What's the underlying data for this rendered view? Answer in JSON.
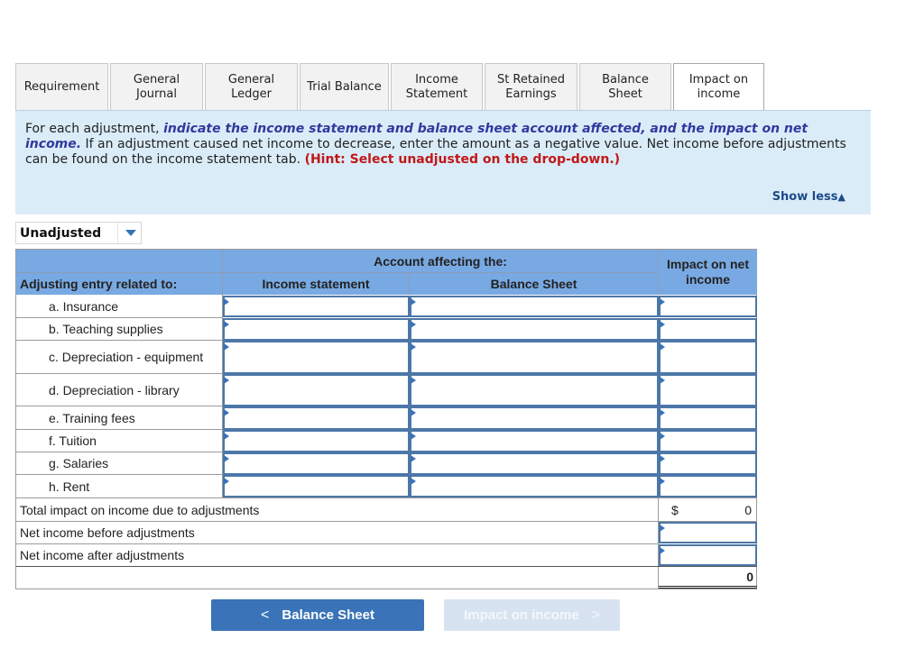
{
  "tabs": [
    {
      "label": "Requirement",
      "active": false
    },
    {
      "label": "General\nJournal",
      "active": false
    },
    {
      "label": "General\nLedger",
      "active": false
    },
    {
      "label": "Trial Balance",
      "active": false
    },
    {
      "label": "Income\nStatement",
      "active": false
    },
    {
      "label": "St Retained\nEarnings",
      "active": false
    },
    {
      "label": "Balance Sheet",
      "active": false
    },
    {
      "label": "Impact on\nincome",
      "active": true
    }
  ],
  "instructions": {
    "part1": "For each adjustment, ",
    "emphasis": "indicate the income statement and balance sheet account affected, and the impact on net income.",
    "part2": " If an adjustment caused net income to decrease, enter the amount as a negative value. Net income before adjustments can be found on the income statement tab. ",
    "hint": "(Hint: Select unadjusted on the drop-down.)",
    "show_less": "Show less",
    "show_less_icon": "triangle-up-icon"
  },
  "dropdown": {
    "selected": "Unadjusted",
    "icon": "chevron-down-icon"
  },
  "table": {
    "header_group": "Account affecting the:",
    "col_entry": "Adjusting entry related to:",
    "col_income_statement": "Income statement",
    "col_balance_sheet": "Balance Sheet",
    "col_impact": "Impact on net income",
    "rows": [
      {
        "label": "a.  Insurance",
        "income_statement": "",
        "balance_sheet": "",
        "impact": ""
      },
      {
        "label": "b.  Teaching supplies",
        "income_statement": "",
        "balance_sheet": "",
        "impact": ""
      },
      {
        "label": "c.  Depreciation - equipment",
        "income_statement": "",
        "balance_sheet": "",
        "impact": ""
      },
      {
        "label": "d.  Depreciation - library",
        "income_statement": "",
        "balance_sheet": "",
        "impact": ""
      },
      {
        "label": "e.  Training fees",
        "income_statement": "",
        "balance_sheet": "",
        "impact": ""
      },
      {
        "label": "f.  Tuition",
        "income_statement": "",
        "balance_sheet": "",
        "impact": ""
      },
      {
        "label": "g.  Salaries",
        "income_statement": "",
        "balance_sheet": "",
        "impact": ""
      },
      {
        "label": "h.  Rent",
        "income_statement": "",
        "balance_sheet": "",
        "impact": ""
      }
    ],
    "total_label": "Total impact on income due to adjustments",
    "total_currency": "$",
    "total_value": "0",
    "before_label": "Net income before adjustments",
    "before_value": "",
    "after_label": "Net income after adjustments",
    "after_value": "",
    "final_value": "0"
  },
  "buttons": {
    "prev_label": "Balance Sheet",
    "prev_icon": "chevron-left-icon",
    "next_label": "Impact on income",
    "next_icon": "chevron-right-icon"
  },
  "colors": {
    "header_blue": "#79a9e2",
    "panel_bg": "#dbecf9",
    "emphasis": "#2f3a9c",
    "hint_red": "#c01818",
    "button_blue": "#3a73b7"
  }
}
